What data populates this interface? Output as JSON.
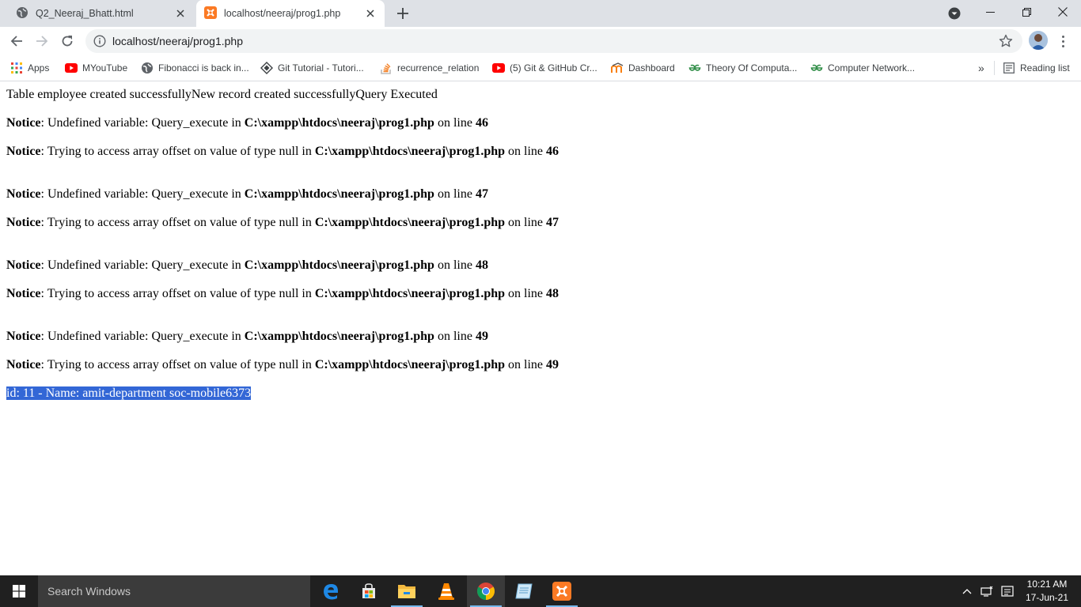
{
  "browser": {
    "tabs": [
      {
        "title": "Q2_Neeraj_Bhatt.html",
        "active": false
      },
      {
        "title": "localhost/neeraj/prog1.php",
        "active": true
      }
    ],
    "url": "localhost/neeraj/prog1.php",
    "bookmarks": [
      {
        "label": "Apps",
        "icon": "apps-grid-icon"
      },
      {
        "label": "MYouTube",
        "icon": "youtube-icon"
      },
      {
        "label": "Fibonacci is back in...",
        "icon": "globe-icon"
      },
      {
        "label": "Git Tutorial - Tutori...",
        "icon": "diamond-icon"
      },
      {
        "label": "recurrence_relation",
        "icon": "stackoverflow-icon"
      },
      {
        "label": "(5) Git & GitHub Cr...",
        "icon": "youtube-icon"
      },
      {
        "label": "Dashboard",
        "icon": "moodle-icon"
      },
      {
        "label": "Theory Of Computa...",
        "icon": "geeksforgeeks-icon"
      },
      {
        "label": "Computer Network...",
        "icon": "geeksforgeeks-icon"
      }
    ],
    "overflow_label": "»",
    "reading_list_label": "Reading list"
  },
  "page": {
    "first_line": "Table employee created successfullyNew record created successfullyQuery Executed",
    "notice_label": "Notice",
    "undefined_msg": ": Undefined variable: Query_execute in ",
    "offset_msg": ": Trying to access array offset on value of type null in ",
    "path": "C:\\xampp\\htdocs\\neeraj\\prog1.php",
    "on_line": " on line ",
    "lines": [
      "46",
      "47",
      "48",
      "49"
    ],
    "result_line": "id: 11 - Name: amit-department soc-mobile6373"
  },
  "taskbar": {
    "search_placeholder": "Search Windows",
    "time": "10:21 AM",
    "date": "17-Jun-21",
    "apps": [
      "edge-icon",
      "store-icon",
      "file-explorer-icon",
      "vlc-icon",
      "chrome-icon",
      "notepad-icon",
      "xampp-icon"
    ]
  }
}
